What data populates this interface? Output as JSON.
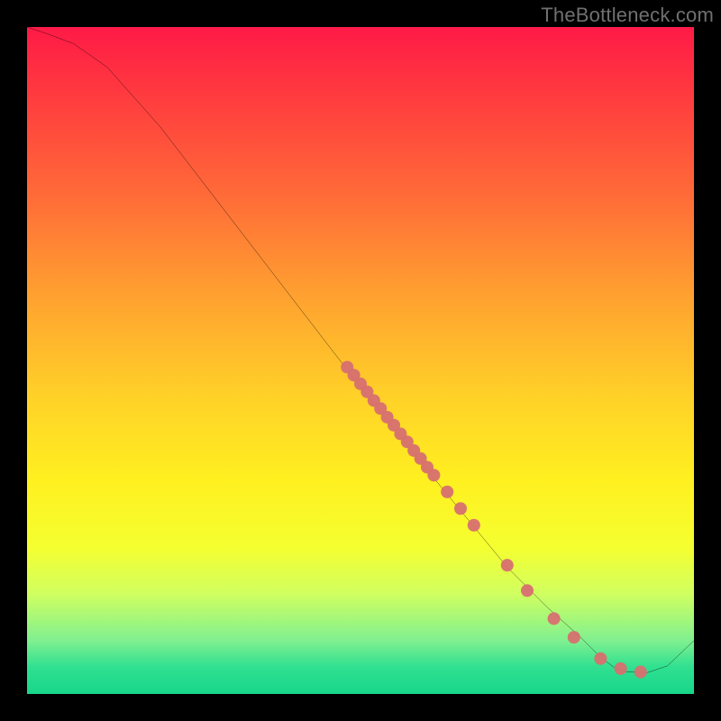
{
  "watermark": "TheBottleneck.com",
  "chart_data": {
    "type": "line",
    "title": "",
    "xlabel": "",
    "ylabel": "",
    "xlim": [
      0,
      100
    ],
    "ylim": [
      0,
      100
    ],
    "curve": {
      "x": [
        0,
        3,
        7,
        12,
        20,
        30,
        40,
        50,
        58,
        65,
        72,
        78,
        83,
        86,
        88,
        90,
        93,
        96,
        100
      ],
      "y": [
        100,
        99,
        97.5,
        94,
        85,
        72,
        59,
        46,
        36,
        27.5,
        19,
        13,
        8.5,
        5.5,
        4,
        3.3,
        3.2,
        4.2,
        8
      ]
    },
    "series": [
      {
        "name": "points",
        "x": [
          48,
          49,
          50,
          51,
          52,
          53,
          54,
          55,
          56,
          57,
          58,
          59,
          60,
          61,
          63,
          65,
          67,
          72,
          75,
          79,
          82,
          86,
          89,
          92
        ],
        "y": [
          49.0,
          47.8,
          46.5,
          45.3,
          44.0,
          42.8,
          41.5,
          40.3,
          39.0,
          37.8,
          36.5,
          35.3,
          34.0,
          32.8,
          30.3,
          27.8,
          25.3,
          19.3,
          15.5,
          11.3,
          8.5,
          5.3,
          3.8,
          3.3
        ]
      }
    ]
  }
}
